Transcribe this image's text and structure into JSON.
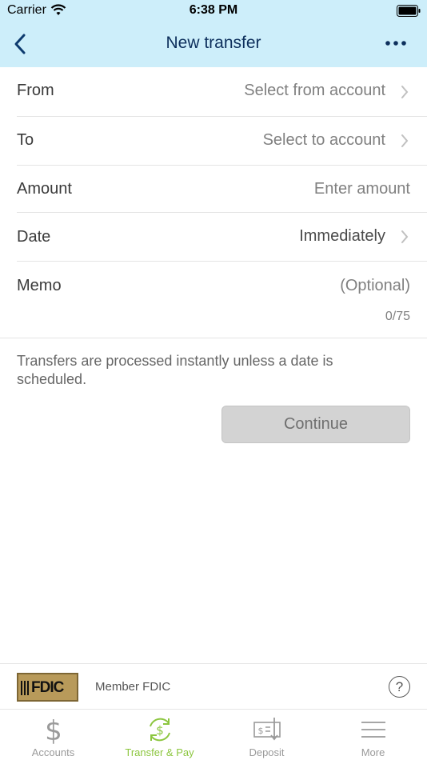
{
  "status_bar": {
    "carrier": "Carrier",
    "time": "6:38 PM"
  },
  "nav": {
    "title": "New transfer",
    "back_icon": "chevron-left-icon",
    "more_icon": "ellipsis-icon"
  },
  "form": {
    "from": {
      "label": "From",
      "value": "Select from account"
    },
    "to": {
      "label": "To",
      "value": "Select to account"
    },
    "amount": {
      "label": "Amount",
      "placeholder": "Enter amount"
    },
    "date": {
      "label": "Date",
      "value": "Immediately"
    },
    "memo": {
      "label": "Memo",
      "placeholder": "(Optional)",
      "counter": "0/75"
    }
  },
  "note": "Transfers are processed instantly unless a date is scheduled.",
  "continue_label": "Continue",
  "footer": {
    "logo_text": "FDIC",
    "member_text": "Member FDIC",
    "help_symbol": "?"
  },
  "tabs": [
    {
      "label": "Accounts",
      "icon": "dollar-icon",
      "active": false
    },
    {
      "label": "Transfer & Pay",
      "icon": "transfer-icon",
      "active": true
    },
    {
      "label": "Deposit",
      "icon": "check-deposit-icon",
      "active": false
    },
    {
      "label": "More",
      "icon": "menu-icon",
      "active": false
    }
  ],
  "colors": {
    "header_bg": "#cdeefa",
    "title": "#0d2f5c",
    "active_tab": "#8cc63f",
    "button_disabled": "#d3d3d3"
  }
}
